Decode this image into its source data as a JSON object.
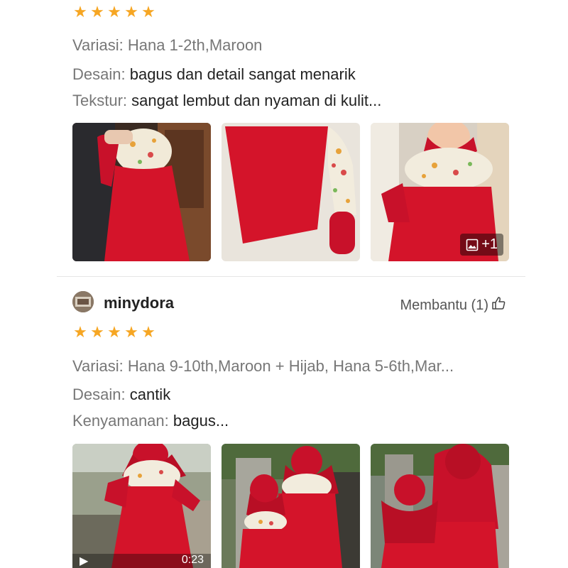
{
  "review1": {
    "rating": 5,
    "variation_label": "Variasi:",
    "variation_value": "Hana 1-2th,Maroon",
    "design_label": "Desain:",
    "design_value": "bagus dan detail sangat menarik",
    "texture_label": "Tekstur:",
    "texture_value": "sangat lembut dan nyaman di kulit...",
    "more_photos": "+1"
  },
  "review2": {
    "username": "minydora",
    "helpful_label": "Membantu (1)",
    "rating": 5,
    "variation_label": "Variasi:",
    "variation_value": "Hana 9-10th,Maroon + Hijab, Hana 5-6th,Mar...",
    "design_label": "Desain:",
    "design_value": "cantik",
    "comfort_label": "Kenyamanan:",
    "comfort_value": "bagus...",
    "video_duration": "0:23"
  },
  "icons": {
    "star": "star-icon",
    "thumbs_up": "thumbs-up-icon",
    "gallery": "image-gallery-icon"
  },
  "colors": {
    "star": "#f6a623",
    "dress_red": "#d4142a",
    "label_grey": "#777777"
  }
}
